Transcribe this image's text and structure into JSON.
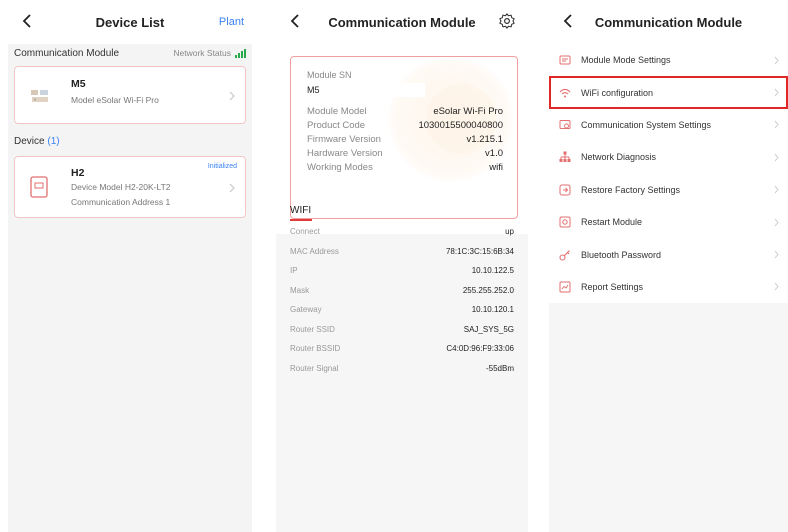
{
  "screen1": {
    "title": "Device List",
    "plant_link": "Plant",
    "comm_section_label": "Communication Module",
    "network_status_label": "Network Status",
    "module_card": {
      "name": "M5",
      "model": "Model  eSolar Wi-Fi Pro"
    },
    "device_label": "Device",
    "device_count": "(1)",
    "device_card": {
      "name": "H2",
      "badge": "Initialized",
      "model": "Device Model  H2-20K-LT2",
      "address": "Communication Address  1"
    }
  },
  "screen2": {
    "title": "Communication Module",
    "sn_label": "Module SN",
    "sn_value": "M5",
    "info": [
      {
        "key": "Module Model",
        "value": "eSolar Wi-Fi Pro"
      },
      {
        "key": "Product Code",
        "value": "1030015500040800"
      },
      {
        "key": "Firmware Version",
        "value": "v1.215.1"
      },
      {
        "key": "Hardware Version",
        "value": "v1.0"
      },
      {
        "key": "Working Modes",
        "value": "wifi"
      }
    ],
    "wifi_title": "WIFI",
    "wifi_rows": [
      {
        "key": "Connect",
        "value": "up"
      },
      {
        "key": "MAC Address",
        "value": "78:1C:3C:15:6B:34"
      },
      {
        "key": "IP",
        "value": "10.10.122.5"
      },
      {
        "key": "Mask",
        "value": "255.255.252.0"
      },
      {
        "key": "Gateway",
        "value": "10.10.120.1"
      },
      {
        "key": "Router SSID",
        "value": "SAJ_SYS_5G"
      },
      {
        "key": "Router BSSID",
        "value": "C4:0D:96:F9:33:06"
      },
      {
        "key": "Router Signal",
        "value": "-55dBm"
      }
    ]
  },
  "screen3": {
    "title": "Communication Module",
    "menu": [
      {
        "label": "Module Mode Settings",
        "icon": "module-mode-icon"
      },
      {
        "label": "WiFi configuration",
        "icon": "wifi-icon",
        "selected": true
      },
      {
        "label": "Communication System Settings",
        "icon": "comm-system-icon"
      },
      {
        "label": "Network Diagnosis",
        "icon": "network-diagnosis-icon"
      },
      {
        "label": "Restore Factory Settings",
        "icon": "restore-icon"
      },
      {
        "label": "Restart Module",
        "icon": "restart-icon"
      },
      {
        "label": "Bluetooth Password",
        "icon": "key-icon"
      },
      {
        "label": "Report Settings",
        "icon": "report-icon"
      }
    ]
  },
  "colors": {
    "accent_blue": "#3b82f6",
    "accent_red": "#e23b3b",
    "signal_green": "#2aa84a",
    "card_border": "#f3c6c6"
  }
}
